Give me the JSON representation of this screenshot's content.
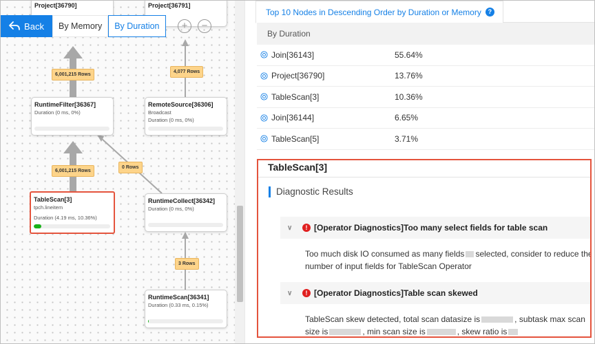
{
  "toolbar": {
    "back_label": "Back",
    "by_memory_label": "By Memory",
    "by_duration_label": "By Duration",
    "zoom_in": "+",
    "zoom_out": "−"
  },
  "graph": {
    "nodes": {
      "project_36790": {
        "title": "Project[36790]"
      },
      "project_36791": {
        "title": "Project[36791]"
      },
      "runtime_filter": {
        "title": "RuntimeFilter[36367]",
        "duration": "Duration (0 ms, 0%)"
      },
      "remote_source": {
        "title": "RemoteSource[36306]",
        "sub": "Broadcast",
        "duration": "Duration (0 ms, 0%)"
      },
      "table_scan": {
        "title": "TableScan[3]",
        "sub": "tpch.lineitem",
        "duration": "Duration (4.19 ms, 10.36%)",
        "progress": 0.1036
      },
      "runtime_collect": {
        "title": "RuntimeCollect[36342]",
        "duration": "Duration (0 ms, 0%)"
      },
      "runtime_scan": {
        "title": "RuntimeScan[36341]",
        "duration": "Duration (0.33 ms, 0.15%)"
      }
    },
    "edges": {
      "e1": "6,001,215 Rows",
      "e2": "4,077 Rows",
      "e3": "6,001,215 Rows",
      "e4": "0 Rows",
      "e5": "3 Rows"
    }
  },
  "panel": {
    "tab_label": "Top 10 Nodes in Descending Order by Duration or Memory",
    "help_icon": "?",
    "column_header": "By Duration",
    "rows": [
      {
        "name": "Join[36143]",
        "pct": "55.64%"
      },
      {
        "name": "Project[36790]",
        "pct": "13.76%"
      },
      {
        "name": "TableScan[3]",
        "pct": "10.36%"
      },
      {
        "name": "Join[36144]",
        "pct": "6.65%"
      },
      {
        "name": "TableScan[5]",
        "pct": "3.71%"
      }
    ]
  },
  "detail": {
    "title": "TableScan[3]",
    "diag_heading": "Diagnostic Results",
    "issue1_title": "[Operator Diagnostics]Too many select fields for table scan",
    "issue1_text_a": "Too much disk IO consumed as many fields",
    "issue1_text_b": "selected, consider to reduce the number of input fields for TableScan Operator",
    "issue2_title": "[Operator Diagnostics]Table scan skewed",
    "issue2_text_a": "TableScan skew detected, total scan datasize is",
    "issue2_text_b": ", subtask max scan size is",
    "issue2_text_c": ", min scan size is",
    "issue2_text_d": ", skew ratio is"
  },
  "colors": {
    "accent": "#1580e6",
    "highlight": "#e4533c",
    "edge_label": "#fdd48a",
    "progress": "#1ab21a",
    "error": "#e02020"
  }
}
